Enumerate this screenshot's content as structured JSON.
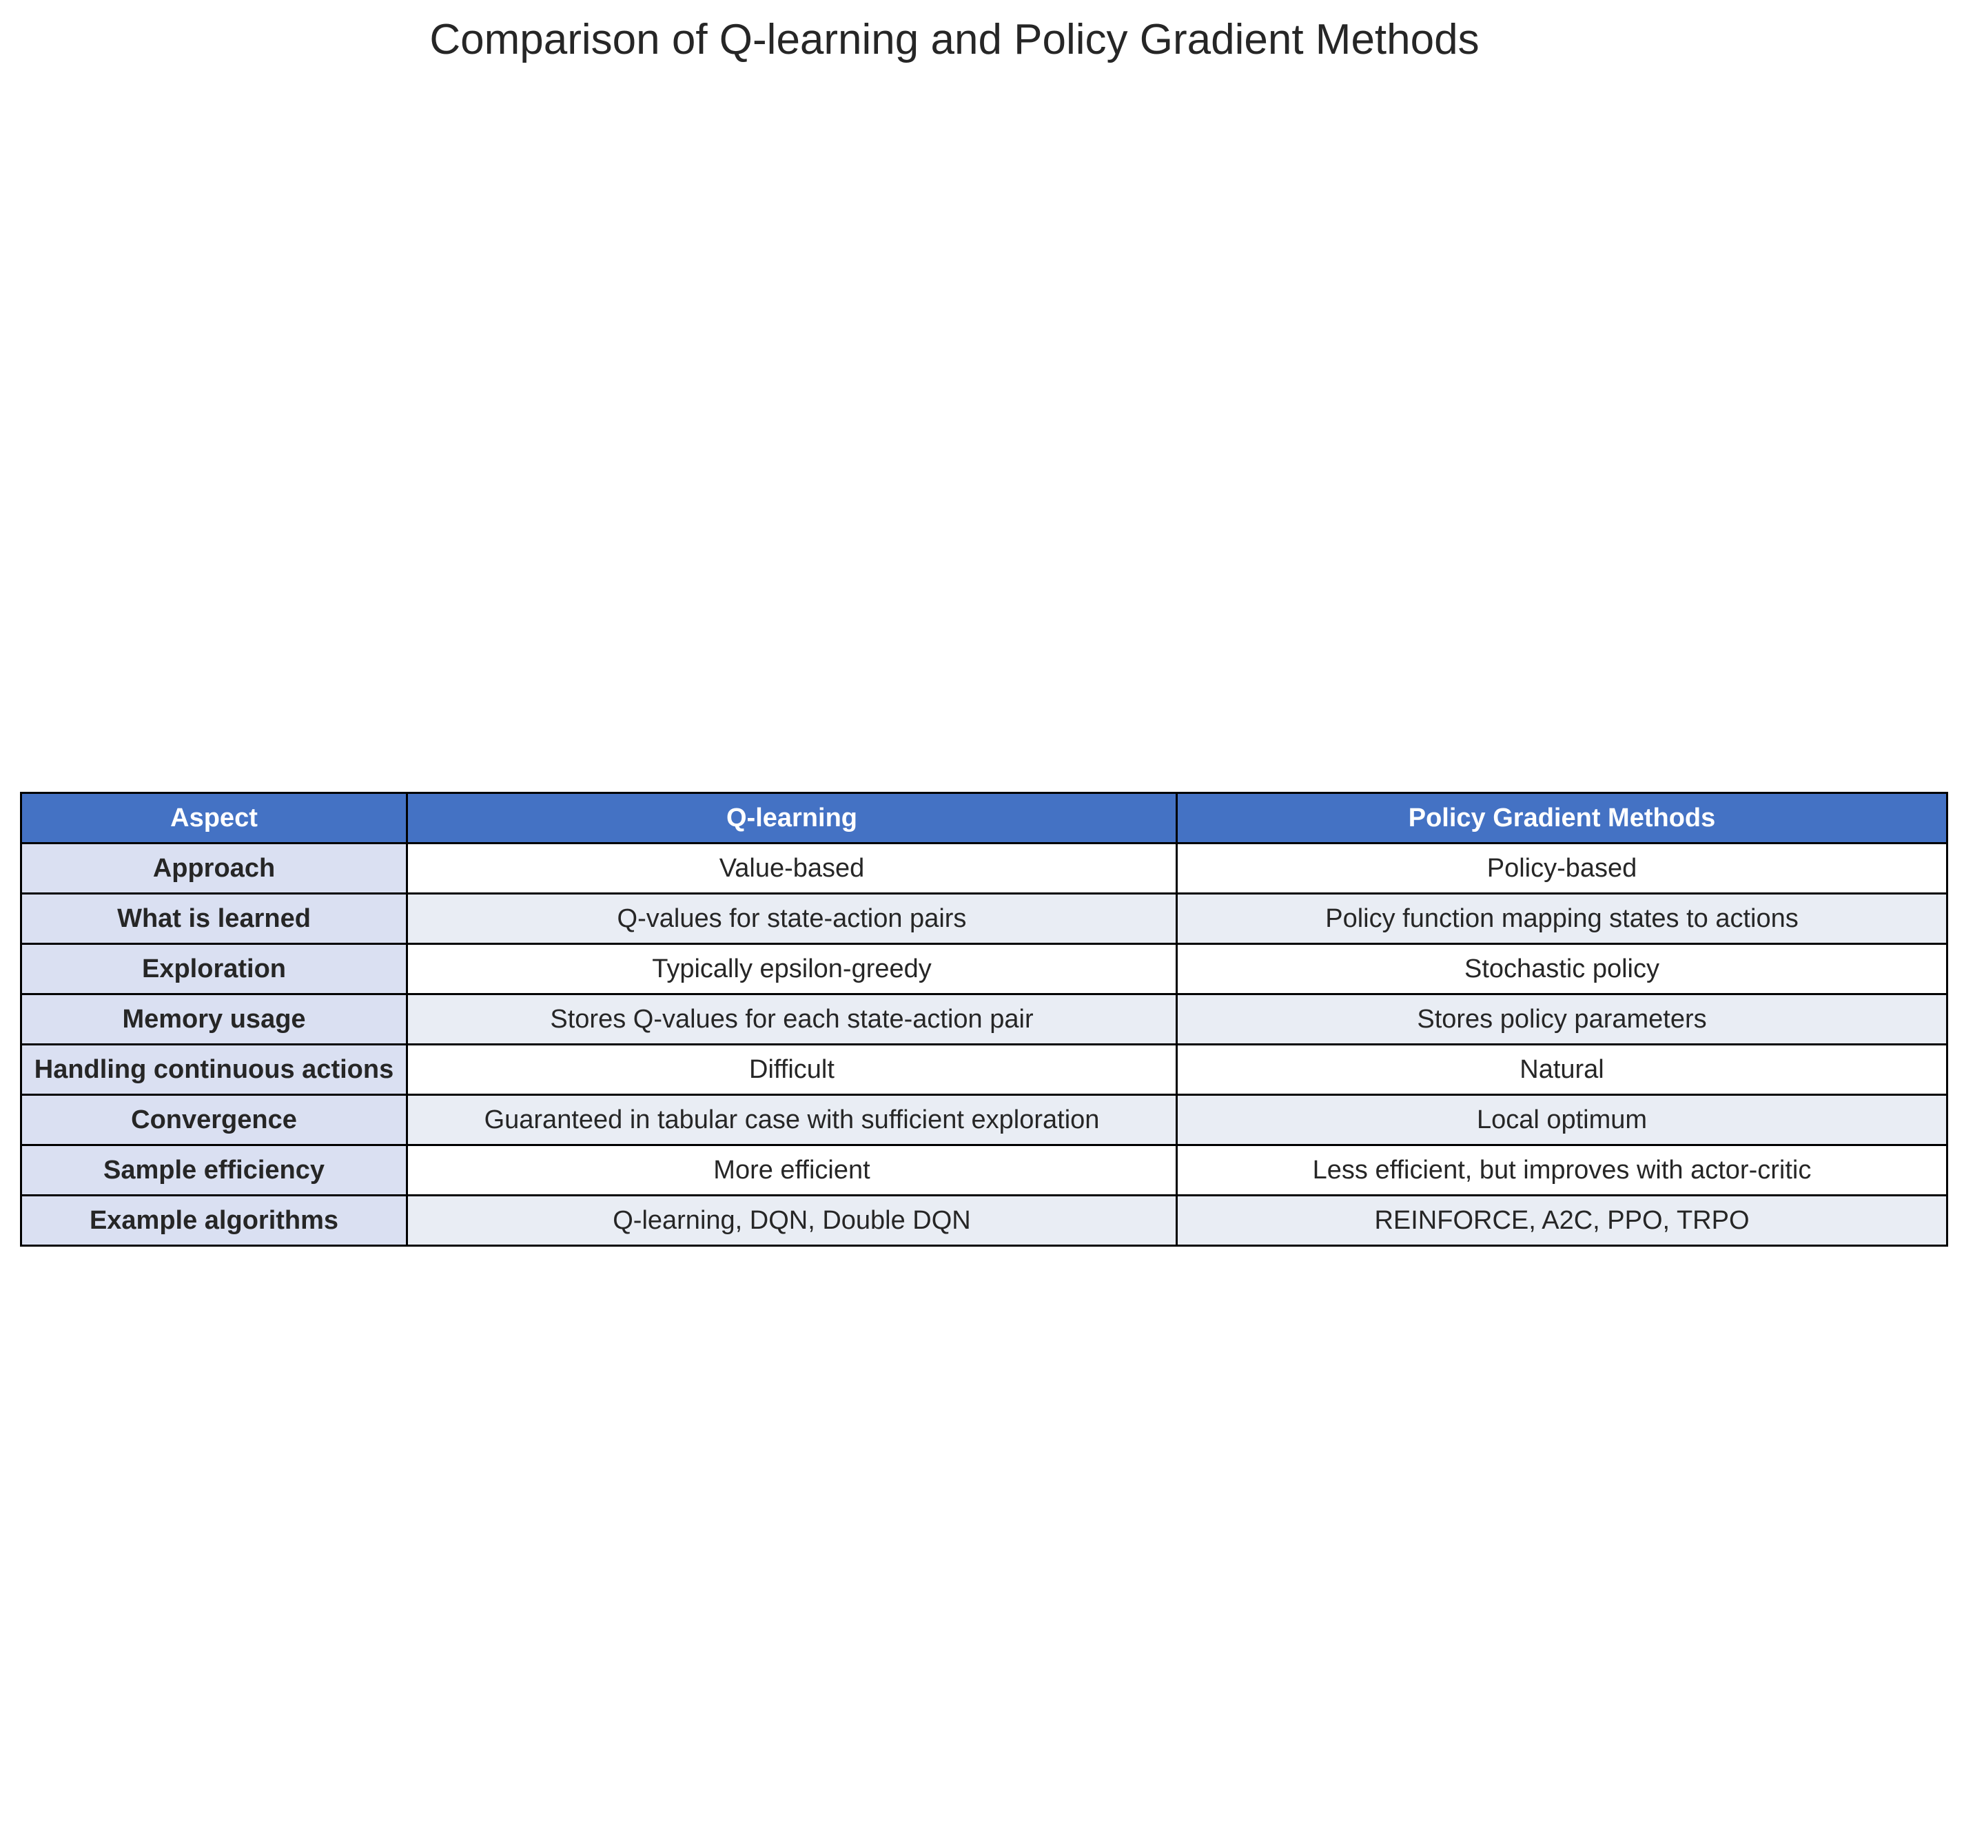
{
  "chart_data": {
    "type": "table",
    "title": "Comparison of Q-learning and Policy Gradient Methods",
    "columns": [
      "Aspect",
      "Q-learning",
      "Policy Gradient Methods"
    ],
    "rows": [
      [
        "Approach",
        "Value-based",
        "Policy-based"
      ],
      [
        "What is learned",
        "Q-values for state-action pairs",
        "Policy function mapping states to actions"
      ],
      [
        "Exploration",
        "Typically epsilon-greedy",
        "Stochastic policy"
      ],
      [
        "Memory usage",
        "Stores Q-values for each state-action pair",
        "Stores policy parameters"
      ],
      [
        "Handling continuous actions",
        "Difficult",
        "Natural"
      ],
      [
        "Convergence",
        "Guaranteed in tabular case with sufficient exploration",
        "Local optimum"
      ],
      [
        "Sample efficiency",
        "More efficient",
        "Less efficient, but improves with actor-critic"
      ],
      [
        "Example algorithms",
        "Q-learning, DQN, Double DQN",
        "REINFORCE, A2C, PPO, TRPO"
      ]
    ]
  },
  "colors": {
    "header_bg": "#4472c4",
    "header_text": "#ffffff",
    "aspect_bg": "#dae0f2",
    "row_alt_bg": "#e9edf4",
    "row_bg": "#ffffff",
    "border": "#000000"
  }
}
